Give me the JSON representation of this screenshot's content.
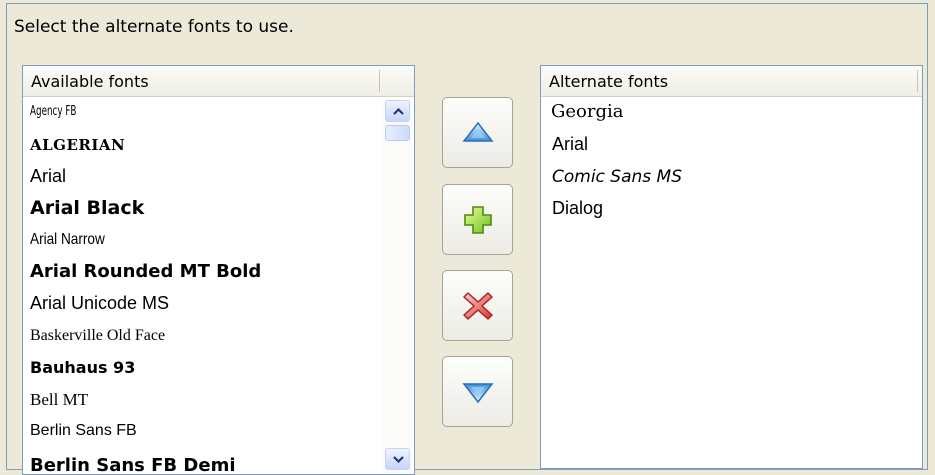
{
  "instruction": "Select the alternate fonts to use.",
  "available_fonts": {
    "header": "Available fonts",
    "items": [
      "Agency FB",
      "ALGERIAN",
      "Arial",
      "Arial Black",
      "Arial Narrow",
      "Arial Rounded MT Bold",
      "Arial Unicode MS",
      "Baskerville Old Face",
      "Bauhaus 93",
      "Bell MT",
      "Berlin Sans FB",
      "Berlin Sans FB Demi"
    ]
  },
  "alternate_fonts": {
    "header": "Alternate fonts",
    "items": [
      "Georgia",
      "Arial",
      "Comic Sans MS",
      "Dialog"
    ]
  },
  "buttons": {
    "move_up": "move-up-arrow-icon",
    "add": "plus-icon",
    "remove": "red-x-icon",
    "move_down": "move-down-arrow-icon"
  },
  "colors": {
    "border": "#7f9db9",
    "arrow_blue": "#3b8ed6",
    "plus_green": "#8fd62b",
    "remove_red": "#d8342c"
  }
}
